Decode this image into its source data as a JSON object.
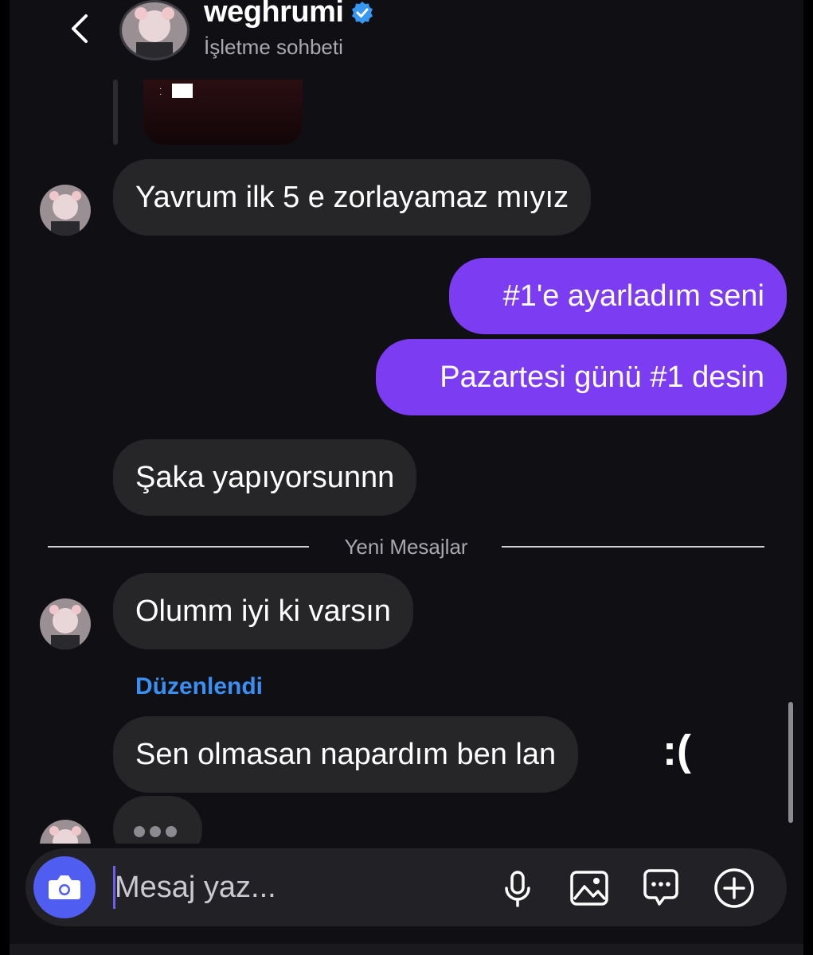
{
  "header": {
    "title": "weghrumi",
    "subtitle": "İşletme sohbeti"
  },
  "messages": {
    "m1": "Yavrum ilk 5 e zorlayamaz mıyız",
    "m2": "#1'e ayarladım seni",
    "m3": "Pazartesi günü #1 desin",
    "m4": "Şaka yapıyorsunnn",
    "m5": "Olumm iyi ki varsın",
    "m6": "Sen olmasan napardım ben lan"
  },
  "divider": {
    "label": "Yeni Mesajlar"
  },
  "edited_label": "Düzenlendi",
  "emote": ":(",
  "composer": {
    "placeholder": "Mesaj yaz..."
  },
  "icons": {
    "back": "chevron-left-icon",
    "verified": "verified-badge-icon",
    "camera": "camera-icon",
    "mic": "microphone-icon",
    "gallery": "image-icon",
    "sticker": "chat-bubble-icon",
    "more": "plus-circle-icon"
  },
  "colors": {
    "background": "#101014",
    "received_bubble": "#262629",
    "sent_bubble": "#7c3df2",
    "camera_button": "#4f5ef0",
    "edited_label": "#3b8ff2",
    "verified": "#3897f0"
  }
}
